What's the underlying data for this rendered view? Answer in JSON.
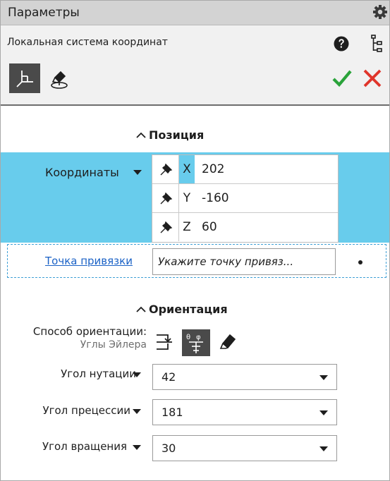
{
  "window": {
    "title": "Параметры"
  },
  "header": {
    "subtitle": "Локальная система координат"
  },
  "position_section": {
    "title": "Позиция"
  },
  "coordinates": {
    "label": "Координаты",
    "rows": [
      {
        "axis": "X",
        "value": "202"
      },
      {
        "axis": "Y",
        "value": "-160"
      },
      {
        "axis": "Z",
        "value": "60"
      }
    ]
  },
  "snap_point": {
    "link_label": "Точка привязки",
    "placeholder": "Укажите точку привяз..."
  },
  "orientation_section": {
    "title": "Ориентация",
    "method_label": "Способ ориентации:",
    "method_value": "Углы Эйлера"
  },
  "angles": [
    {
      "label": "Угол нутации",
      "value": "42"
    },
    {
      "label": "Угол прецессии",
      "value": "181"
    },
    {
      "label": "Угол вращения",
      "value": "30"
    }
  ],
  "colors": {
    "accent_highlight": "#68ccec",
    "ok_green": "#2aa33a",
    "cancel_red": "#e0352b",
    "link_blue": "#1b62c6"
  }
}
